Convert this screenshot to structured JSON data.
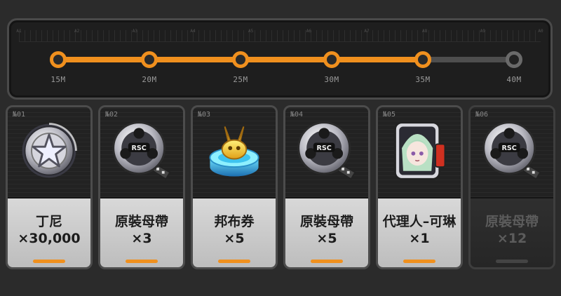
{
  "track": {
    "ruler_labels": [
      "A1",
      "A2",
      "A3",
      "A4",
      "A5",
      "A6",
      "A7",
      "A8",
      "A9",
      "A0"
    ],
    "milestones": [
      {
        "label": "15M",
        "reached": true
      },
      {
        "label": "20M",
        "reached": true
      },
      {
        "label": "25M",
        "reached": true
      },
      {
        "label": "30M",
        "reached": true
      },
      {
        "label": "35M",
        "reached": true
      },
      {
        "label": "40M",
        "reached": false
      }
    ],
    "progress_fraction": 0.8,
    "colors": {
      "active": "#f0901e",
      "inactive": "#6a6a6a"
    }
  },
  "rewards": [
    {
      "number": "№01",
      "name": "丁尼",
      "quantity": "×30,000",
      "icon": "dennies-coin-icon",
      "claimed": true
    },
    {
      "number": "№02",
      "name": "原裝母帶",
      "quantity": "×3",
      "icon": "master-tape-icon",
      "claimed": true
    },
    {
      "number": "№03",
      "name": "邦布券",
      "quantity": "×5",
      "icon": "bangboo-ticket-icon",
      "claimed": true
    },
    {
      "number": "№04",
      "name": "原裝母帶",
      "quantity": "×5",
      "icon": "master-tape-icon",
      "claimed": true
    },
    {
      "number": "№05",
      "name": "代理人–可琳",
      "quantity": "×1",
      "icon": "agent-corin-portrait-icon",
      "claimed": true
    },
    {
      "number": "№06",
      "name": "原裝母帶",
      "quantity": "×12",
      "icon": "master-tape-icon",
      "claimed": false
    }
  ]
}
